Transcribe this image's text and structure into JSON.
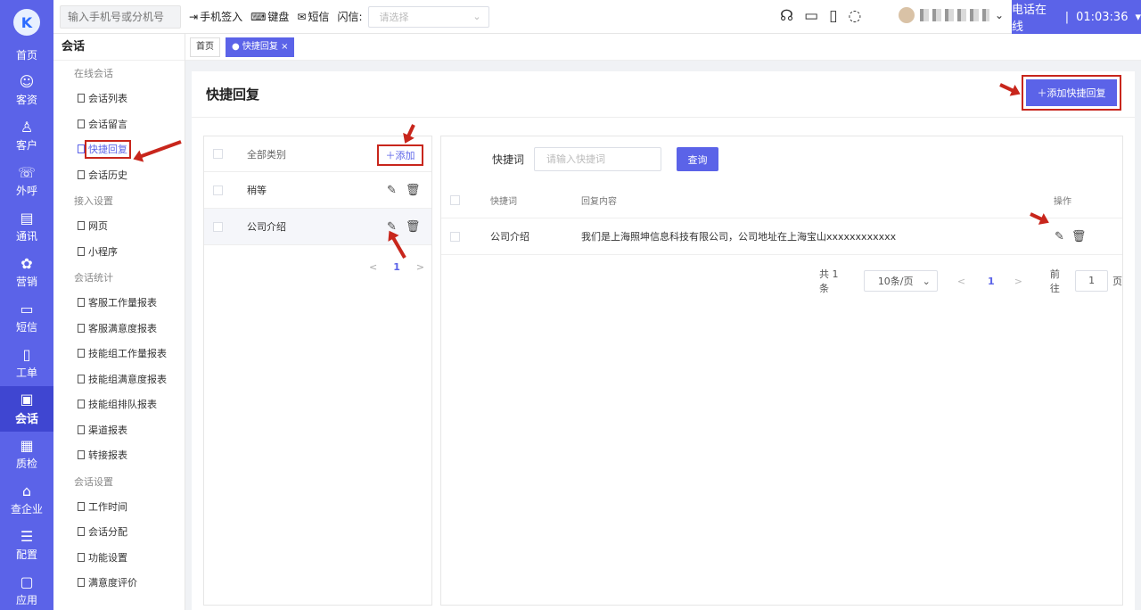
{
  "rail": {
    "logo": "K",
    "items": [
      {
        "label": "首页",
        "icon": "home-icon",
        "glyph": ""
      },
      {
        "label": "客资",
        "icon": "contacts-icon",
        "glyph": "☺"
      },
      {
        "label": "客户",
        "icon": "customer-icon",
        "glyph": "♙"
      },
      {
        "label": "外呼",
        "icon": "outbound-call-icon",
        "glyph": "☏"
      },
      {
        "label": "通讯",
        "icon": "directory-icon",
        "glyph": "▤"
      },
      {
        "label": "营销",
        "icon": "marketing-icon",
        "glyph": "✿"
      },
      {
        "label": "短信",
        "icon": "sms-icon",
        "glyph": "▭"
      },
      {
        "label": "工单",
        "icon": "ticket-icon",
        "glyph": "▯"
      },
      {
        "label": "会话",
        "icon": "chat-icon",
        "glyph": "▣"
      },
      {
        "label": "质检",
        "icon": "quality-check-icon",
        "glyph": "▦"
      },
      {
        "label": "查企业",
        "icon": "company-search-icon",
        "glyph": "⌂"
      },
      {
        "label": "配置",
        "icon": "settings-icon",
        "glyph": "☰"
      },
      {
        "label": "应用",
        "icon": "apps-icon",
        "glyph": "▢"
      }
    ],
    "active_index": 8
  },
  "topbar": {
    "phone_placeholder": "输入手机号或分机号",
    "phone_checkin": "手机签入",
    "keyboard": "键盘",
    "sms": "短信",
    "flash_label": "闪信:",
    "flash_placeholder": "请选择",
    "status": "电话在线",
    "separator": "|",
    "timer": "01:03:36"
  },
  "submenu": {
    "title": "会话",
    "sections": [
      {
        "group": "在线会话",
        "items": [
          "会话列表",
          "会话留言",
          "快捷回复",
          "会话历史"
        ]
      },
      {
        "group": "接入设置",
        "items": [
          "网页",
          "小程序"
        ]
      },
      {
        "group": "会话统计",
        "items": [
          "客服工作量报表",
          "客服满意度报表",
          "技能组工作量报表",
          "技能组满意度报表",
          "技能组排队报表",
          "渠道报表",
          "转接报表"
        ]
      },
      {
        "group": "会话设置",
        "items": [
          "工作时间",
          "会话分配",
          "功能设置",
          "满意度评价"
        ]
      }
    ],
    "active_item": "快捷回复"
  },
  "tabs": [
    {
      "label": "首页"
    },
    {
      "label": "● 快捷回复 ×"
    }
  ],
  "page": {
    "title": "快捷回复",
    "add_button": "＋添加快捷回复"
  },
  "categories": {
    "header": "全部类别",
    "add": "＋添加",
    "rows": [
      "稍等",
      "公司介绍"
    ],
    "pager": {
      "prev": "<",
      "page": "1",
      "next": ">"
    }
  },
  "replies": {
    "search_label": "快捷词",
    "search_placeholder": "请输入快捷词",
    "search_button": "查询",
    "columns": [
      "快捷词",
      "回复内容",
      "操作"
    ],
    "rows": [
      {
        "keyword": "公司介绍",
        "content": "我们是上海照坤信息科技有限公司，公司地址在上海宝山xxxxxxxxxxxx"
      }
    ],
    "pagination": {
      "total": "共 1 条",
      "page_size": "10条/页",
      "prev": "<",
      "page": "1",
      "next": ">",
      "goto": "前往",
      "goto_value": "1",
      "page_unit": "页"
    }
  }
}
